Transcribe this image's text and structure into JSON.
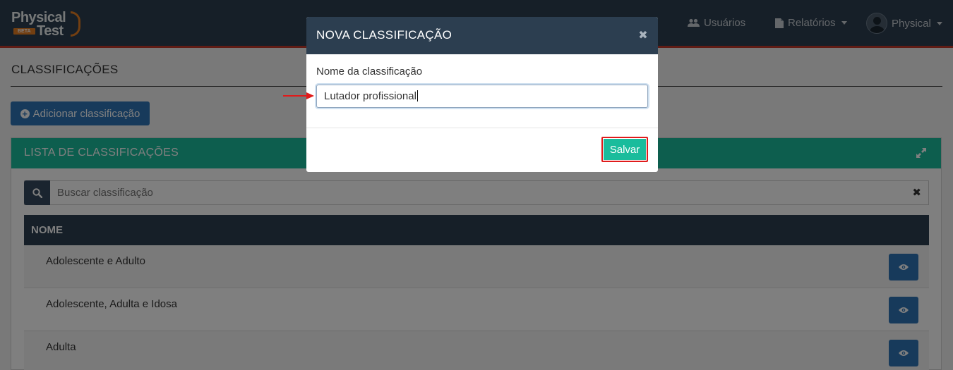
{
  "brand": {
    "line1": "Physical",
    "line2": "Test",
    "badge": "BETA"
  },
  "navbar": {
    "users_label": "Usuários",
    "reports_label": "Relatórios",
    "profile_label": "Physical"
  },
  "page": {
    "title": "CLASSIFICAÇÕES",
    "add_button_label": "Adicionar classificação"
  },
  "panel": {
    "title": "LISTA DE CLASSIFICAÇÕES",
    "search_placeholder": "Buscar classificação",
    "clear_symbol": "✖",
    "column_header": "NOME",
    "rows": [
      {
        "name": "Adolescente e Adulto"
      },
      {
        "name": "Adolescente, Adulta e Idosa"
      },
      {
        "name": "Adulta"
      }
    ]
  },
  "modal": {
    "title": "NOVA CLASSIFICAÇÃO",
    "close_symbol": "✖",
    "field_label": "Nome da classificação",
    "field_value": "Lutador profissional",
    "save_label": "Salvar"
  },
  "colors": {
    "navbar": "#2c3e50",
    "accent_teal": "#1abc9c",
    "primary_blue": "#2e75b6",
    "highlight_red": "#e01b1b",
    "nav_underline": "#c0392b"
  },
  "icons": {
    "users": "users-icon",
    "reports": "file-icon",
    "add": "plus-circle-icon",
    "expand": "expand-icon",
    "search": "search-icon",
    "view": "eye-icon",
    "annotation": "arrow-annotation-icon"
  }
}
